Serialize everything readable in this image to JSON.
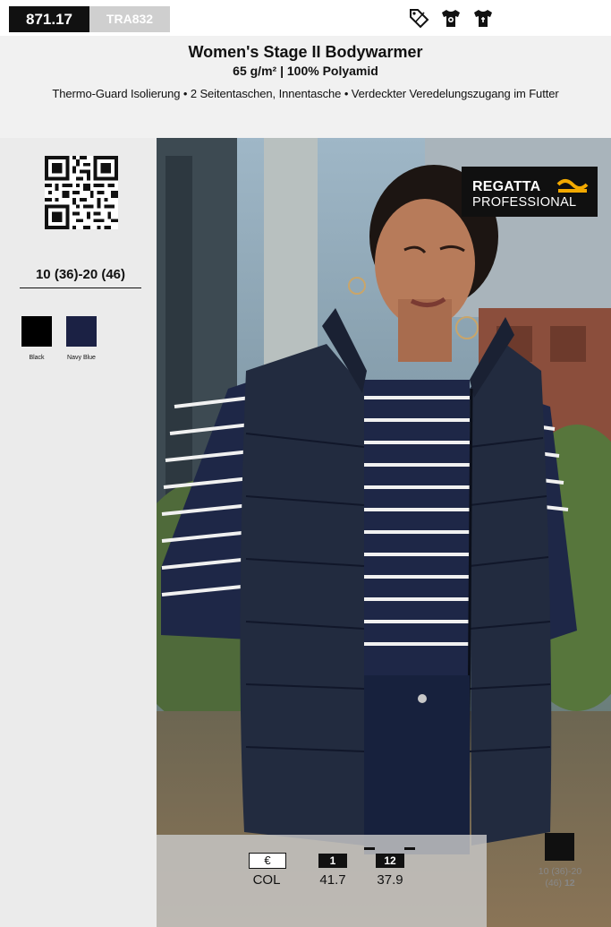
{
  "header": {
    "article_number": "871.17",
    "article_code": "TRA832",
    "icons": [
      "discount-tag-icon",
      "tshirt-printing-icon",
      "tshirt-embroidery-icon"
    ],
    "title": "Women's Stage II Bodywarmer",
    "subtitle": "65 g/m² | 100% Polyamid",
    "features": "Thermo-Guard Isolierung • 2 Seitentaschen, Innentasche • Verdeckter Veredelungszugang im Futter"
  },
  "sidebar": {
    "size_range": "10 (36)-20 (46)",
    "colors": [
      {
        "name": "Black",
        "hex": "#000000"
      },
      {
        "name": "Navy Blue",
        "hex": "#1b2144"
      }
    ]
  },
  "brand": {
    "line1": "REGATTA",
    "line2": "PROFESSIONAL",
    "accent": "#f2a900"
  },
  "pricing": {
    "currency_label": "€",
    "currency_sub": "COL",
    "tiers": [
      {
        "qty": "1",
        "price": "41.7"
      },
      {
        "qty": "12",
        "price": "37.9"
      }
    ]
  },
  "variant": {
    "size_text": "10 (36)-20",
    "size_text2": "(46)",
    "qty": "12"
  }
}
